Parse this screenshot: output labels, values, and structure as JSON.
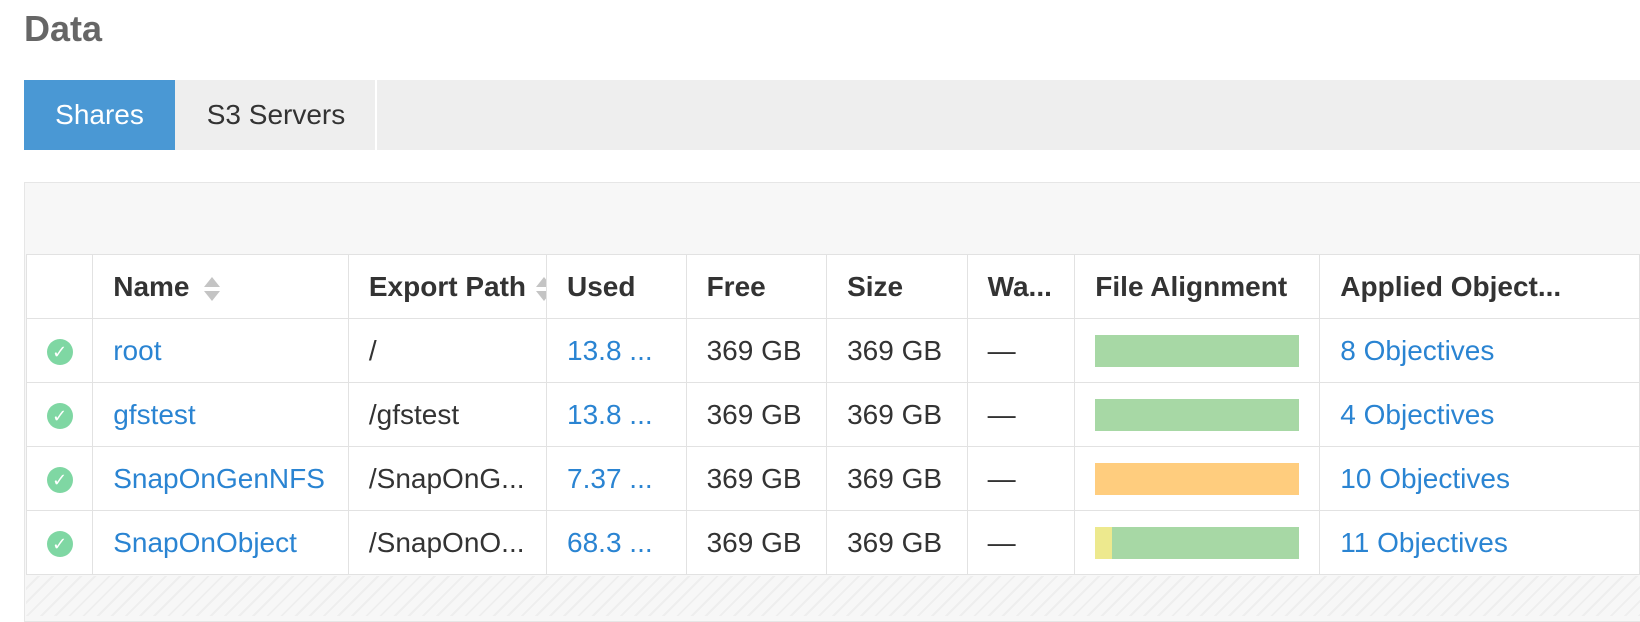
{
  "page": {
    "title": "Data"
  },
  "tabs": [
    {
      "label": "Shares",
      "active": true
    },
    {
      "label": "S3 Servers",
      "active": false
    }
  ],
  "table": {
    "columns": [
      "",
      "Name",
      "Export Path",
      "Used",
      "Free",
      "Size",
      "Wa...",
      "File Alignment",
      "Applied Object..."
    ],
    "rows": [
      {
        "status": "ok",
        "name": "root",
        "export_path": "/",
        "used": "13.8 ...",
        "free": "369 GB",
        "size": "369 GB",
        "wa": "—",
        "alignment": [
          {
            "state": "aligned",
            "fraction": 1.0
          }
        ],
        "objectives": "8 Objectives"
      },
      {
        "status": "ok",
        "name": "gfstest",
        "export_path": "/gfstest",
        "used": "13.8 ...",
        "free": "369 GB",
        "size": "369 GB",
        "wa": "—",
        "alignment": [
          {
            "state": "aligned",
            "fraction": 1.0
          }
        ],
        "objectives": "4 Objectives"
      },
      {
        "status": "ok",
        "name": "SnapOnGenNFS",
        "export_path": "/SnapOnG...",
        "used": "7.37 ...",
        "free": "369 GB",
        "size": "369 GB",
        "wa": "—",
        "alignment": [
          {
            "state": "pending",
            "fraction": 1.0
          }
        ],
        "objectives": "10 Objectives"
      },
      {
        "status": "ok",
        "name": "SnapOnObject",
        "export_path": "/SnapOnO...",
        "used": "68.3 ...",
        "free": "369 GB",
        "size": "369 GB",
        "wa": "—",
        "alignment": [
          {
            "state": "partial",
            "fraction": 0.08
          },
          {
            "state": "aligned",
            "fraction": 0.92
          }
        ],
        "objectives": "11 Objectives"
      }
    ]
  },
  "colors": {
    "accent": "#4a98d4",
    "link": "#2a84d2",
    "status_ok": "#7fd7a3",
    "alignment_aligned": "#a7d8a5",
    "alignment_pending": "#ffcd7e",
    "alignment_partial": "#ede98e"
  },
  "icons": {
    "status_ok": "check-circle-icon",
    "sort": "sort-icon"
  }
}
